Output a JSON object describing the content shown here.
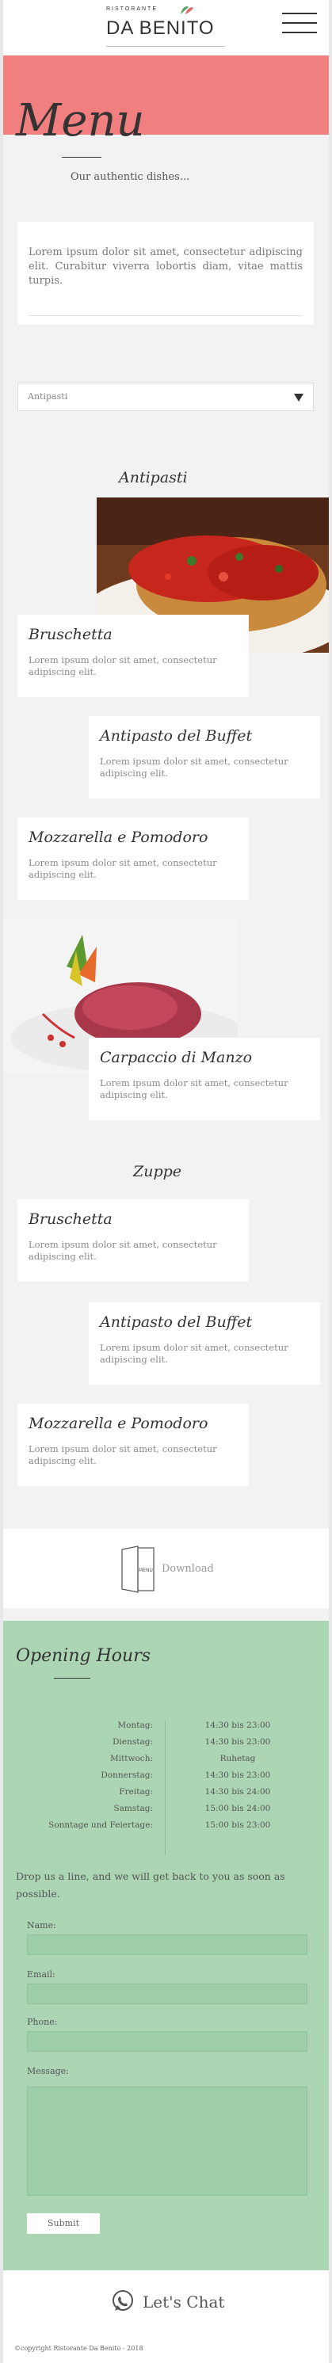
{
  "header": {
    "logo_small": "RISTORANTE",
    "logo_main": "DA BENITO",
    "menu_icon": "hamburger-icon"
  },
  "menu": {
    "title": "Menu",
    "subtitle": "Our authentic dishes...",
    "intro": "Lorem ipsum dolor sit amet, consectetur adipiscing elit. Curabitur viverra lobortis diam, vitae mattis turpis.",
    "category_select": "Antipasti"
  },
  "sections": [
    {
      "title": "Antipasti",
      "items": [
        {
          "name": "Bruschetta",
          "desc": "Lorem ipsum dolor sit amet, consectetur adipiscing elit."
        },
        {
          "name": "Antipasto del Buffet",
          "desc": "Lorem ipsum dolor sit amet, consectetur adipiscing elit."
        },
        {
          "name": "Mozzarella e Pomodoro",
          "desc": "Lorem ipsum dolor sit amet, consectetur adipiscing elit."
        },
        {
          "name": "Carpaccio di Manzo",
          "desc": "Lorem ipsum dolor sit amet, consectetur adipiscing elit."
        }
      ]
    },
    {
      "title": "Zuppe",
      "items": [
        {
          "name": "Bruschetta",
          "desc": "Lorem ipsum dolor sit amet, consectetur adipiscing elit."
        },
        {
          "name": "Antipasto del Buffet",
          "desc": "Lorem ipsum dolor sit amet, consectetur adipiscing elit."
        },
        {
          "name": "Mozzarella e Pomodoro",
          "desc": "Lorem ipsum dolor sit amet, consectetur adipiscing elit."
        }
      ]
    }
  ],
  "download": {
    "icon_text": "MENU",
    "label": "Download"
  },
  "hours": {
    "title": "Opening Hours",
    "rows": [
      {
        "day": "Montag:",
        "time": "14:30 bis 23:00"
      },
      {
        "day": "Dienstag:",
        "time": "14:30 bis 23:00"
      },
      {
        "day": "Mittwoch:",
        "time": "Ruhetag"
      },
      {
        "day": "Donnerstag:",
        "time": "14:30 bis 23:00"
      },
      {
        "day": "Freitag:",
        "time": "14:30 bis 24:00"
      },
      {
        "day": "Samstag:",
        "time": "15:00 bis 24:00"
      },
      {
        "day": "Sonntage und Feiertage:",
        "time": "15:00 bis 23:00"
      }
    ]
  },
  "contact": {
    "intro": "Drop us a line, and we will get back to you as soon as possible.",
    "name_label": "Name:",
    "email_label": "Email:",
    "phone_label": "Phone:",
    "message_label": "Message:",
    "submit": "Submit"
  },
  "chat": {
    "label": "Let's Chat"
  },
  "footer": {
    "copyright": "©copyright Ristorante Da Benito - 2018"
  },
  "colors": {
    "accent_red": "#f27f7f",
    "hours_green": "#acd5b4",
    "field_green": "#9dcea8"
  }
}
